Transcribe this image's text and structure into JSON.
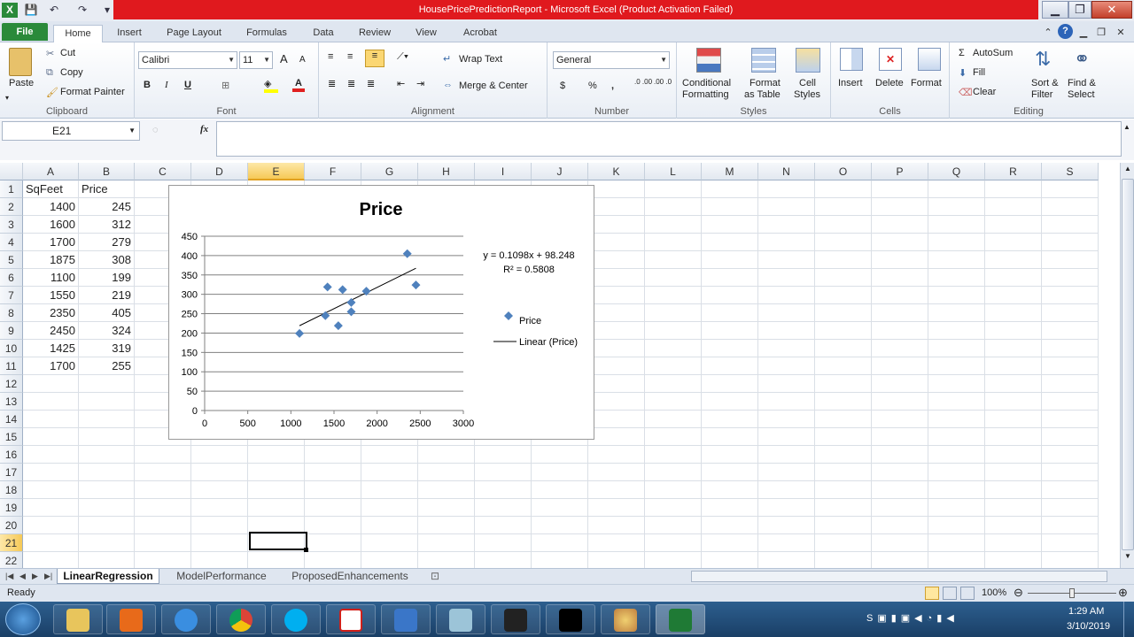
{
  "window": {
    "title": "HousePricePredictionReport  -  Microsoft Excel (Product Activation Failed)",
    "minimize_icon": "minimize-icon",
    "restore_icon": "restore-icon",
    "close_icon": "close-icon"
  },
  "qat": {
    "excel": "X",
    "save": "💾",
    "undo": "↶",
    "redo": "↷",
    "more": "▾"
  },
  "tabs": [
    "File",
    "Home",
    "Insert",
    "Page Layout",
    "Formulas",
    "Data",
    "Review",
    "View",
    "Acrobat"
  ],
  "ribbon": {
    "clipboard": {
      "paste": "Paste",
      "cut": "Cut",
      "copy": "Copy",
      "format_painter": "Format Painter",
      "label": "Clipboard"
    },
    "font": {
      "name": "Calibri",
      "size": "11",
      "grow": "A",
      "shrink": "A",
      "bold": "B",
      "italic": "I",
      "underline": "U",
      "label": "Font"
    },
    "alignment": {
      "wrap": "Wrap Text",
      "merge": "Merge & Center",
      "label": "Alignment"
    },
    "number": {
      "format": "General",
      "currency": "$",
      "percent": "%",
      "comma": ",",
      "inc_dec": ".0 .00",
      "dec_dec": ".00 .0",
      "label": "Number"
    },
    "styles": {
      "conditional": "Conditional",
      "conditional2": "Formatting",
      "format_table": "Format",
      "format_table2": "as Table",
      "cell": "Cell",
      "cell2": "Styles",
      "label": "Styles"
    },
    "cells": {
      "insert": "Insert",
      "delete": "Delete",
      "format": "Format",
      "label": "Cells"
    },
    "editing": {
      "autosum": "AutoSum",
      "fill": "Fill",
      "clear": "Clear",
      "sort": "Sort &",
      "sort2": "Filter",
      "find": "Find &",
      "find2": "Select",
      "label": "Editing"
    }
  },
  "formula_bar": {
    "name_box": "E21",
    "fx": "fx",
    "value": ""
  },
  "columns": [
    "A",
    "B",
    "C",
    "D",
    "E",
    "F",
    "G",
    "H",
    "I",
    "J",
    "K",
    "L",
    "M",
    "N",
    "O",
    "P",
    "Q",
    "R",
    "S"
  ],
  "rows": [
    "1",
    "2",
    "3",
    "4",
    "5",
    "6",
    "7",
    "8",
    "9",
    "10",
    "11",
    "12",
    "13",
    "14",
    "15",
    "16",
    "17",
    "18",
    "19",
    "20",
    "21",
    "22"
  ],
  "table": {
    "headers": [
      "SqFeet",
      "Price"
    ],
    "data": [
      [
        "1400",
        "245"
      ],
      [
        "1600",
        "312"
      ],
      [
        "1700",
        "279"
      ],
      [
        "1875",
        "308"
      ],
      [
        "1100",
        "199"
      ],
      [
        "1550",
        "219"
      ],
      [
        "2350",
        "405"
      ],
      [
        "2450",
        "324"
      ],
      [
        "1425",
        "319"
      ],
      [
        "1700",
        "255"
      ]
    ]
  },
  "chart_data": {
    "type": "scatter",
    "title": "Price",
    "x": [
      1400,
      1600,
      1700,
      1875,
      1100,
      1550,
      2350,
      2450,
      1425,
      1700
    ],
    "y": [
      245,
      312,
      279,
      308,
      199,
      219,
      405,
      324,
      319,
      255
    ],
    "xlim": [
      0,
      3000
    ],
    "ylim": [
      0,
      450
    ],
    "xticks": [
      "0",
      "500",
      "1000",
      "1500",
      "2000",
      "2500",
      "3000"
    ],
    "yticks": [
      "0",
      "50",
      "100",
      "150",
      "200",
      "250",
      "300",
      "350",
      "400",
      "450"
    ],
    "trendline": {
      "slope": 0.1098,
      "intercept": 98.248,
      "equation": "y = 0.1098x + 98.248",
      "r2": "R² = 0.5808"
    },
    "legend": [
      "Price",
      "Linear (Price)"
    ],
    "legend_position": "right",
    "grid": true,
    "marker_color": "#4f81bd"
  },
  "sheets": [
    "LinearRegression",
    "ModelPerformance",
    "ProposedEnhancements"
  ],
  "status": {
    "ready": "Ready",
    "zoom": "100%"
  },
  "taskbar": {
    "time": "1:29 AM",
    "date": "3/10/2019"
  }
}
